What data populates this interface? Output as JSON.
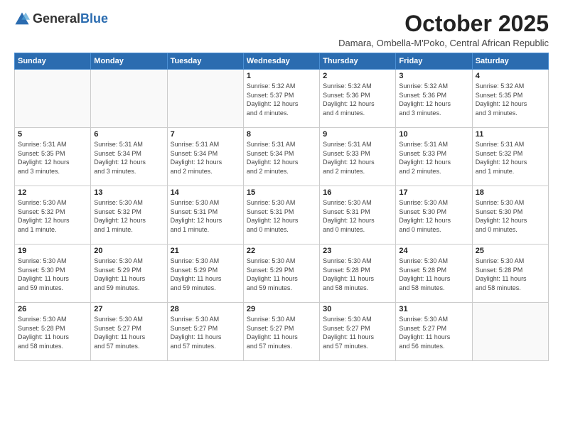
{
  "logo": {
    "general": "General",
    "blue": "Blue"
  },
  "header": {
    "title": "October 2025",
    "subtitle": "Damara, Ombella-M'Poko, Central African Republic"
  },
  "weekdays": [
    "Sunday",
    "Monday",
    "Tuesday",
    "Wednesday",
    "Thursday",
    "Friday",
    "Saturday"
  ],
  "rows": [
    [
      {
        "day": "",
        "info": ""
      },
      {
        "day": "",
        "info": ""
      },
      {
        "day": "",
        "info": ""
      },
      {
        "day": "1",
        "info": "Sunrise: 5:32 AM\nSunset: 5:37 PM\nDaylight: 12 hours\nand 4 minutes."
      },
      {
        "day": "2",
        "info": "Sunrise: 5:32 AM\nSunset: 5:36 PM\nDaylight: 12 hours\nand 4 minutes."
      },
      {
        "day": "3",
        "info": "Sunrise: 5:32 AM\nSunset: 5:36 PM\nDaylight: 12 hours\nand 3 minutes."
      },
      {
        "day": "4",
        "info": "Sunrise: 5:32 AM\nSunset: 5:35 PM\nDaylight: 12 hours\nand 3 minutes."
      }
    ],
    [
      {
        "day": "5",
        "info": "Sunrise: 5:31 AM\nSunset: 5:35 PM\nDaylight: 12 hours\nand 3 minutes."
      },
      {
        "day": "6",
        "info": "Sunrise: 5:31 AM\nSunset: 5:34 PM\nDaylight: 12 hours\nand 3 minutes."
      },
      {
        "day": "7",
        "info": "Sunrise: 5:31 AM\nSunset: 5:34 PM\nDaylight: 12 hours\nand 2 minutes."
      },
      {
        "day": "8",
        "info": "Sunrise: 5:31 AM\nSunset: 5:34 PM\nDaylight: 12 hours\nand 2 minutes."
      },
      {
        "day": "9",
        "info": "Sunrise: 5:31 AM\nSunset: 5:33 PM\nDaylight: 12 hours\nand 2 minutes."
      },
      {
        "day": "10",
        "info": "Sunrise: 5:31 AM\nSunset: 5:33 PM\nDaylight: 12 hours\nand 2 minutes."
      },
      {
        "day": "11",
        "info": "Sunrise: 5:31 AM\nSunset: 5:32 PM\nDaylight: 12 hours\nand 1 minute."
      }
    ],
    [
      {
        "day": "12",
        "info": "Sunrise: 5:30 AM\nSunset: 5:32 PM\nDaylight: 12 hours\nand 1 minute."
      },
      {
        "day": "13",
        "info": "Sunrise: 5:30 AM\nSunset: 5:32 PM\nDaylight: 12 hours\nand 1 minute."
      },
      {
        "day": "14",
        "info": "Sunrise: 5:30 AM\nSunset: 5:31 PM\nDaylight: 12 hours\nand 1 minute."
      },
      {
        "day": "15",
        "info": "Sunrise: 5:30 AM\nSunset: 5:31 PM\nDaylight: 12 hours\nand 0 minutes."
      },
      {
        "day": "16",
        "info": "Sunrise: 5:30 AM\nSunset: 5:31 PM\nDaylight: 12 hours\nand 0 minutes."
      },
      {
        "day": "17",
        "info": "Sunrise: 5:30 AM\nSunset: 5:30 PM\nDaylight: 12 hours\nand 0 minutes."
      },
      {
        "day": "18",
        "info": "Sunrise: 5:30 AM\nSunset: 5:30 PM\nDaylight: 12 hours\nand 0 minutes."
      }
    ],
    [
      {
        "day": "19",
        "info": "Sunrise: 5:30 AM\nSunset: 5:30 PM\nDaylight: 11 hours\nand 59 minutes."
      },
      {
        "day": "20",
        "info": "Sunrise: 5:30 AM\nSunset: 5:29 PM\nDaylight: 11 hours\nand 59 minutes."
      },
      {
        "day": "21",
        "info": "Sunrise: 5:30 AM\nSunset: 5:29 PM\nDaylight: 11 hours\nand 59 minutes."
      },
      {
        "day": "22",
        "info": "Sunrise: 5:30 AM\nSunset: 5:29 PM\nDaylight: 11 hours\nand 59 minutes."
      },
      {
        "day": "23",
        "info": "Sunrise: 5:30 AM\nSunset: 5:28 PM\nDaylight: 11 hours\nand 58 minutes."
      },
      {
        "day": "24",
        "info": "Sunrise: 5:30 AM\nSunset: 5:28 PM\nDaylight: 11 hours\nand 58 minutes."
      },
      {
        "day": "25",
        "info": "Sunrise: 5:30 AM\nSunset: 5:28 PM\nDaylight: 11 hours\nand 58 minutes."
      }
    ],
    [
      {
        "day": "26",
        "info": "Sunrise: 5:30 AM\nSunset: 5:28 PM\nDaylight: 11 hours\nand 58 minutes."
      },
      {
        "day": "27",
        "info": "Sunrise: 5:30 AM\nSunset: 5:27 PM\nDaylight: 11 hours\nand 57 minutes."
      },
      {
        "day": "28",
        "info": "Sunrise: 5:30 AM\nSunset: 5:27 PM\nDaylight: 11 hours\nand 57 minutes."
      },
      {
        "day": "29",
        "info": "Sunrise: 5:30 AM\nSunset: 5:27 PM\nDaylight: 11 hours\nand 57 minutes."
      },
      {
        "day": "30",
        "info": "Sunrise: 5:30 AM\nSunset: 5:27 PM\nDaylight: 11 hours\nand 57 minutes."
      },
      {
        "day": "31",
        "info": "Sunrise: 5:30 AM\nSunset: 5:27 PM\nDaylight: 11 hours\nand 56 minutes."
      },
      {
        "day": "",
        "info": ""
      }
    ]
  ]
}
